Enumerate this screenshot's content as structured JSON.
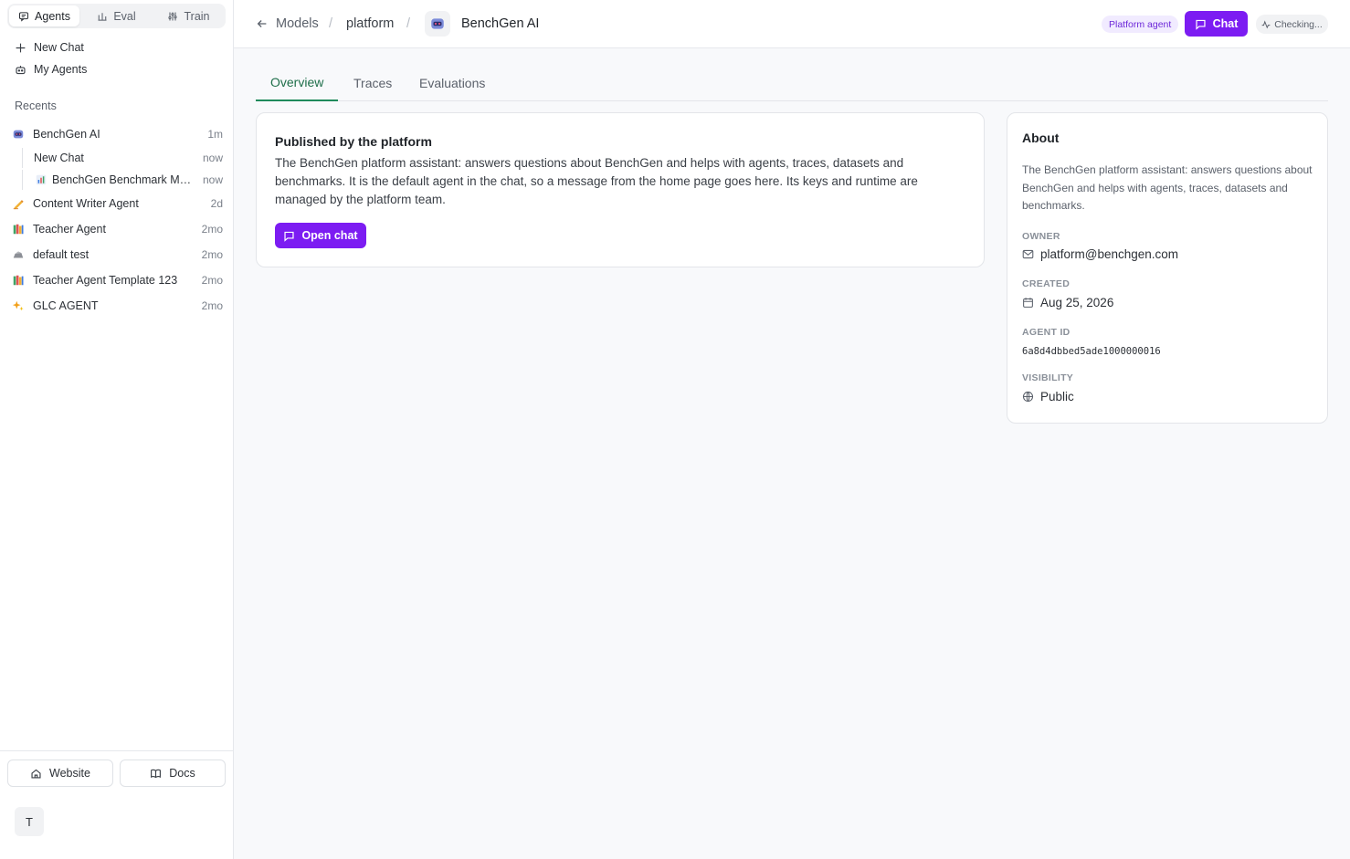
{
  "sidebar": {
    "modes": [
      {
        "label": "Agents",
        "icon": "chat-icon",
        "active": true
      },
      {
        "label": "Eval",
        "icon": "lab-icon",
        "active": false
      },
      {
        "label": "Train",
        "icon": "sliders-icon",
        "active": false
      }
    ],
    "new_chat": "New Chat",
    "my_agents": "My Agents",
    "recents_title": "Recents",
    "recents": [
      {
        "label": "BenchGen AI",
        "time": "1m",
        "icon": "robot-icon"
      },
      {
        "label": "New Chat",
        "time": "now",
        "child": true
      },
      {
        "label": "BenchGen Benchmark Man...",
        "time": "now",
        "child": true,
        "icon": "bar-chart-icon"
      },
      {
        "label": "Content Writer Agent",
        "time": "2d",
        "icon": "writing-hand-icon"
      },
      {
        "label": "Teacher Agent",
        "time": "2mo",
        "icon": "books-icon"
      },
      {
        "label": "default test",
        "time": "2mo",
        "icon": "rock-icon"
      },
      {
        "label": "Teacher Agent Template 123",
        "time": "2mo",
        "icon": "books-icon"
      },
      {
        "label": "GLC AGENT",
        "time": "2mo",
        "icon": "sparkles-icon"
      }
    ],
    "footer": {
      "website": "Website",
      "docs": "Docs",
      "user_initial": "T"
    }
  },
  "header": {
    "back_label": "Models",
    "org": "platform",
    "agent_name": "BenchGen AI",
    "badge": "Platform agent",
    "chat_button": "Chat",
    "status": "Checking..."
  },
  "tabs": [
    "Overview",
    "Traces",
    "Evaluations"
  ],
  "published": {
    "title": "Published by the platform",
    "description": "The BenchGen platform assistant: answers questions about BenchGen and helps with agents, traces, datasets and benchmarks. It is the default agent in the chat, so a message from the home page goes here. Its keys and runtime are managed by the platform team.",
    "button": "Open chat"
  },
  "about": {
    "title": "About",
    "description": "The BenchGen platform assistant: answers questions about BenchGen and helps with agents, traces, datasets and benchmarks.",
    "owner_label": "OWNER",
    "owner": "platform@benchgen.com",
    "created_label": "CREATED",
    "created": "Aug 25, 2026",
    "agent_id_label": "AGENT ID",
    "agent_id": "6a8d4dbbed5ade1000000016",
    "visibility_label": "VISIBILITY",
    "visibility": "Public"
  },
  "colors": {
    "accent": "#7c1cf2",
    "active_tab": "#1f8a5b",
    "badge_bg": "#f1ebff"
  }
}
